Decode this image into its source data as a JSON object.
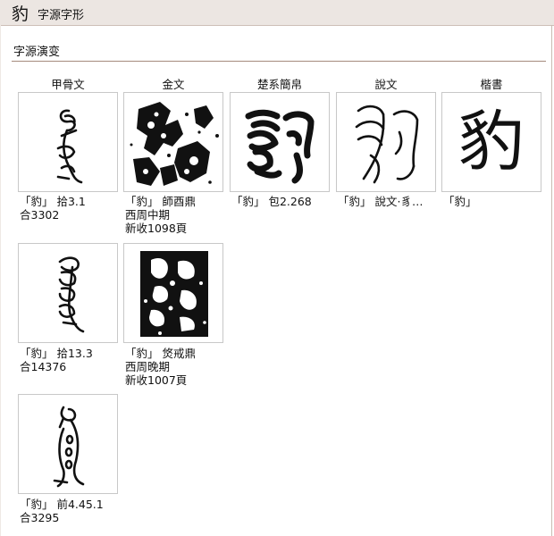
{
  "titlebar": {
    "char": "豹",
    "label": "字源字形"
  },
  "section": {
    "title": "字源演变"
  },
  "columns": [
    "甲骨文",
    "金文",
    "楚系簡帛",
    "說文",
    "楷書"
  ],
  "items": [
    {
      "script": "甲骨文",
      "art": "oracle-1",
      "caption": [
        "「豹」 拾3.1",
        "合3302"
      ]
    },
    {
      "script": "金文",
      "art": "bronze-1",
      "caption": [
        "「豹」 師酉鼎",
        "西周中期",
        "新收1098頁"
      ]
    },
    {
      "script": "楚系簡帛",
      "art": "chu-1",
      "caption": [
        "「豹」 包2.268"
      ]
    },
    {
      "script": "說文",
      "art": "shuowen-1",
      "caption": [
        "「豹」 說文·豸…"
      ]
    },
    {
      "script": "楷書",
      "glyph": "豹",
      "caption": [
        "「豹」"
      ]
    },
    {
      "script": "甲骨文",
      "art": "oracle-2",
      "caption": [
        "「豹」 拾13.3",
        "合14376"
      ]
    },
    {
      "script": "金文",
      "art": "bronze-2",
      "caption": [
        "「豹」 焂戒鼎",
        "西周晚期",
        "新收1007頁"
      ]
    },
    {
      "script": "甲骨文",
      "art": "oracle-3",
      "caption": [
        "「豹」 前4.45.1",
        "合3295"
      ]
    }
  ]
}
